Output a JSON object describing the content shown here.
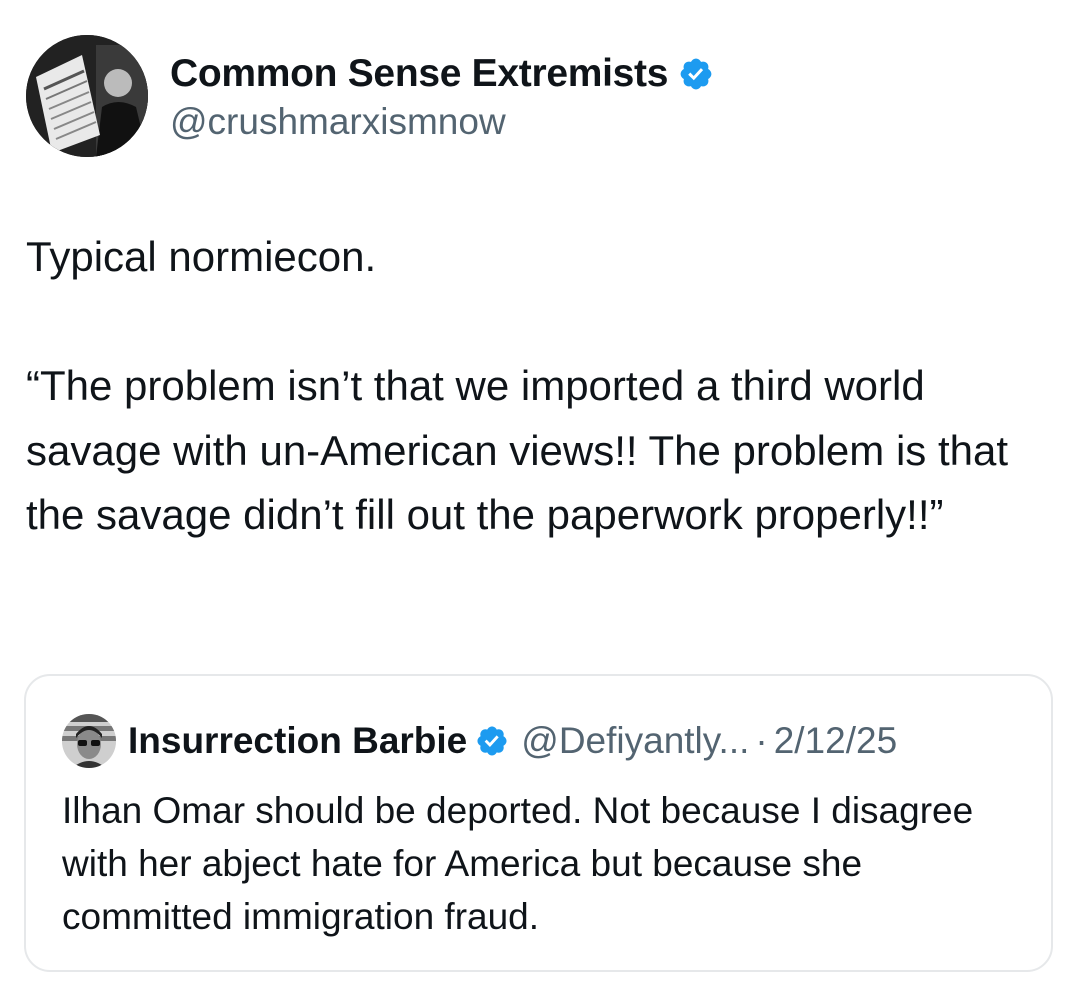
{
  "author": {
    "display_name": "Common Sense Extremists",
    "handle": "@crushmarxismnow",
    "verified_icon": "verified-badge-icon",
    "verified_color": "#1d9bf0"
  },
  "tweet": {
    "line1": "Typical normiecon.",
    "quote": "“The problem isn’t that we imported a third world savage with un-American views!! The problem is that the savage didn’t fill out the paperwork properly!!”"
  },
  "quoted_tweet": {
    "display_name": "Insurrection Barbie",
    "handle": "@Defiyantly...",
    "separator": "·",
    "date": "2/12/25",
    "text": "Ilhan Omar should be deported. Not because I disagree with her abject hate for America but because she committed immigration fraud."
  },
  "colors": {
    "text_primary": "#0f1419",
    "text_secondary": "#536471",
    "border": "#e6e8ea",
    "verified_blue": "#1d9bf0"
  }
}
